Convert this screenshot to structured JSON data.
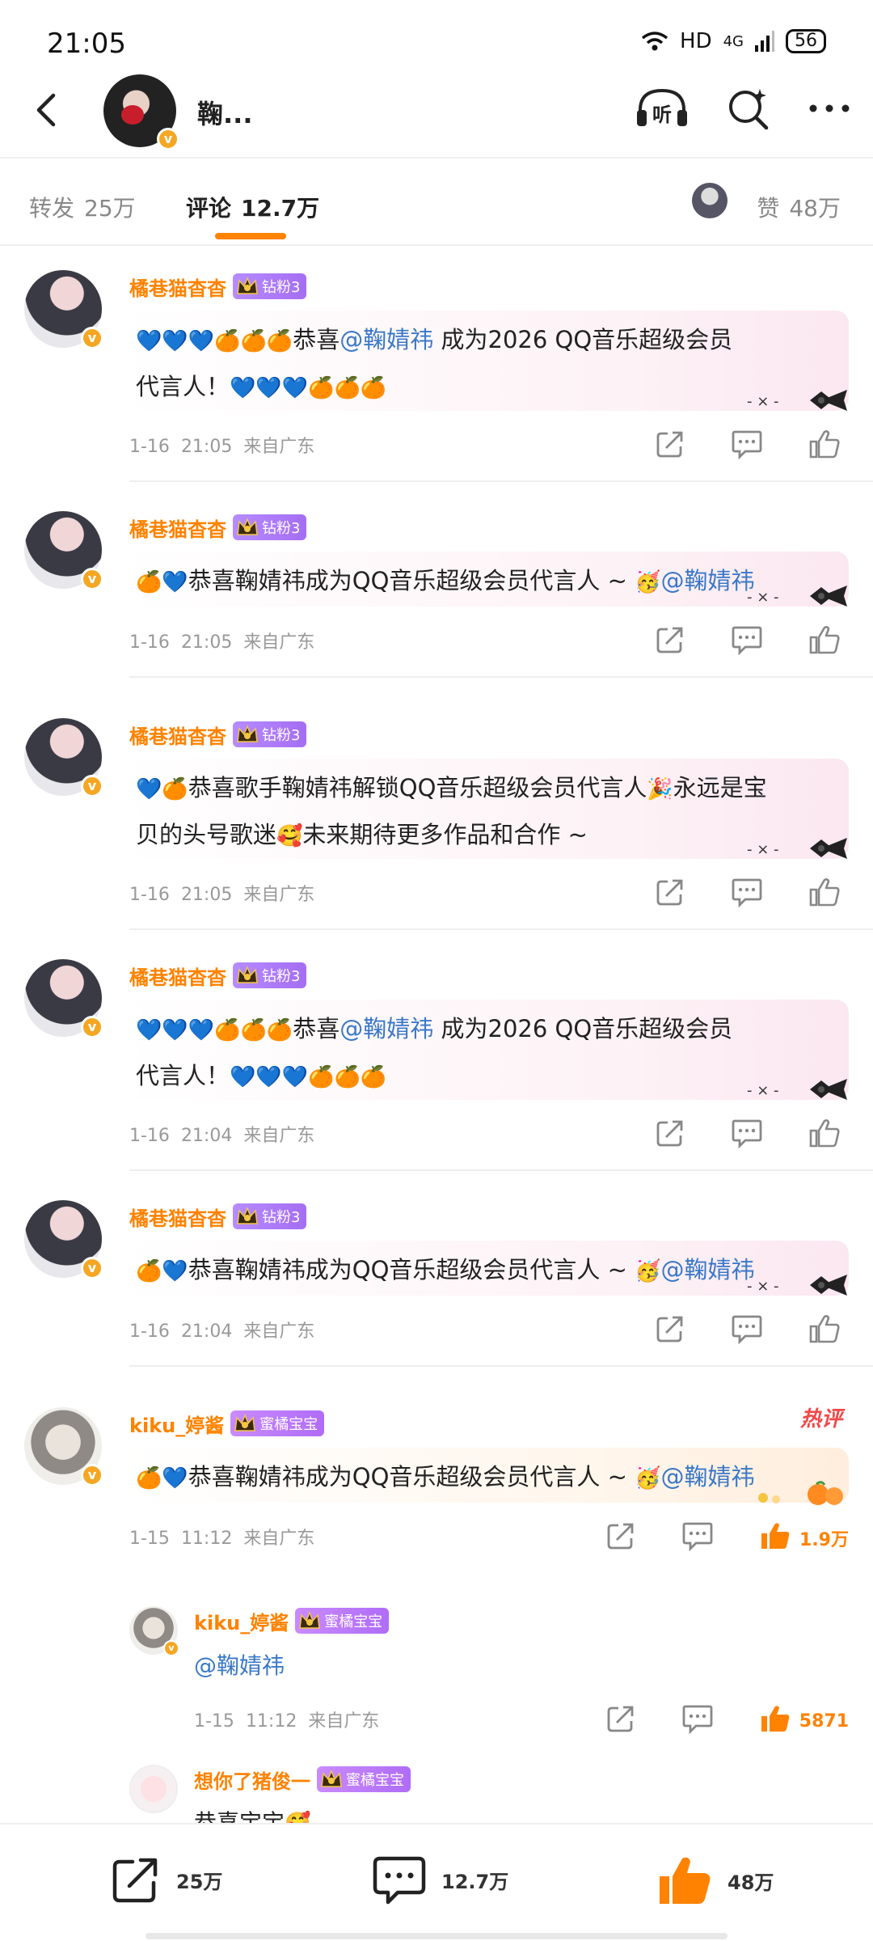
{
  "status_bar": {
    "time": "21:05",
    "network": "HD",
    "signal": "4G",
    "battery": "56"
  },
  "header": {
    "title": "鞠...",
    "icons": [
      "listen-icon",
      "search-icon",
      "more-icon"
    ]
  },
  "tabs": {
    "repost": {
      "label": "转发",
      "count": "25万"
    },
    "comment": {
      "label": "评论",
      "count": "12.7万"
    },
    "like": {
      "label": "赞",
      "count": "48万"
    }
  },
  "comments": [
    {
      "user": "橘巷猫杳杳",
      "badge": "钻粉3",
      "line1": {
        "emojis_before": "💙💙💙🍊🍊🍊",
        "text_before": "恭喜",
        "mention": "@鞠婧祎",
        "text_after": " 成为2026 QQ音乐超级会员"
      },
      "line2": {
        "text_before": "代言人！",
        "emojis_after": "💙💙💙🍊🍊🍊"
      },
      "date": "1-16",
      "time": "21:05",
      "location": "来自广东"
    },
    {
      "user": "橘巷猫杳杳",
      "badge": "钻粉3",
      "line1": {
        "emojis_before": "🍊💙",
        "text_before": "恭喜鞠婧祎成为QQ音乐超级会员代言人 ~ ",
        "emoji_mid": "🥳",
        "mention": "@鞠婧祎"
      },
      "date": "1-16",
      "time": "21:05",
      "location": "来自广东"
    },
    {
      "user": "橘巷猫杳杳",
      "badge": "钻粉3",
      "line1": {
        "emojis_before": "💙🍊",
        "text_before": "恭喜歌手鞠婧祎解锁QQ音乐超级会员代言人",
        "emoji_mid": "🎉",
        "text_after": "永远是宝"
      },
      "line2": {
        "text_before": "贝的头号歌迷",
        "emoji_mid": "🥰",
        "text_after": "未来期待更多作品和合作 ~"
      },
      "date": "1-16",
      "time": "21:05",
      "location": "来自广东"
    },
    {
      "user": "橘巷猫杳杳",
      "badge": "钻粉3",
      "line1": {
        "emojis_before": "💙💙💙🍊🍊🍊",
        "text_before": "恭喜",
        "mention": "@鞠婧祎",
        "text_after": " 成为2026 QQ音乐超级会员"
      },
      "line2": {
        "text_before": "代言人！",
        "emojis_after": "💙💙💙🍊🍊🍊"
      },
      "date": "1-16",
      "time": "21:04",
      "location": "来自广东"
    },
    {
      "user": "橘巷猫杳杳",
      "badge": "钻粉3",
      "line1": {
        "emojis_before": "🍊💙",
        "text_before": "恭喜鞠婧祎成为QQ音乐超级会员代言人 ~ ",
        "emoji_mid": "🥳",
        "mention": "@鞠婧祎"
      },
      "date": "1-16",
      "time": "21:04",
      "location": "来自广东"
    },
    {
      "user": "kiku_婷酱",
      "badge": "蜜橘宝宝",
      "hot": "热评",
      "line1": {
        "emojis_before": "🍊💙",
        "text_before": "恭喜鞠婧祎成为QQ音乐超级会员代言人 ~ ",
        "emoji_mid": "🥳",
        "mention": "@鞠婧祎"
      },
      "date": "1-15",
      "time": "11:12",
      "location": "来自广东",
      "likes": "1.9万"
    }
  ],
  "replies": [
    {
      "user": "kiku_婷酱",
      "badge": "蜜橘宝宝",
      "text": "@鞠婧祎",
      "date": "1-15",
      "time": "11:12",
      "location": "来自广东",
      "likes": "5871"
    },
    {
      "user": "想你了猪俊一",
      "badge": "蜜橘宝宝",
      "text": "恭喜宝宝",
      "emoji": "🥰"
    }
  ],
  "bottom_bar": {
    "repost": "25万",
    "comment": "12.7万",
    "like": "48万"
  },
  "colors": {
    "accent": "#ff8200",
    "mention": "#3b78c8",
    "hot": "#f24848",
    "badge_purple": "#a56df2"
  }
}
